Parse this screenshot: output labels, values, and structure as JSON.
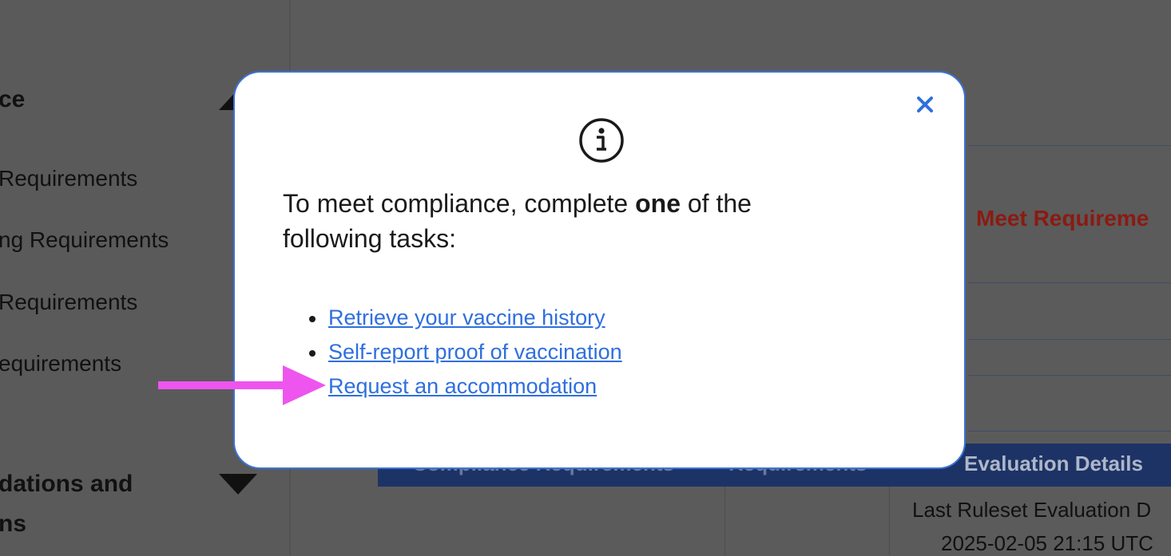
{
  "background": {
    "sidebar": {
      "section_top_title": "ce",
      "items": [
        " Requirements",
        "ng Requirements",
        "Requirements",
        "equirements"
      ],
      "section_bottom_title_line1": "dations and",
      "section_bottom_title_line2": "ns"
    },
    "main": {
      "status_text": "Meet Requireme",
      "table_headers": [
        "Compliance Requirements",
        "Requirements",
        "Evaluation Details"
      ],
      "last_evaluation_label": "Last Ruleset Evaluation D",
      "last_evaluation_value": "2025-02-05 21:15 UTC"
    }
  },
  "modal": {
    "heading_prefix": "To meet compliance, complete ",
    "heading_emphasis": "one",
    "heading_suffix": " of the following tasks:",
    "tasks": [
      "Retrieve your vaccine history",
      "Self-report proof of vaccination",
      "Request an accommodation"
    ],
    "close_icon": "close-icon",
    "info_icon": "info-icon"
  },
  "annotation": {
    "arrow_color": "#ee55ee",
    "arrow_target": "Request an accommodation"
  },
  "colors": {
    "link": "#2f6fde",
    "modal_border": "#3a73d9",
    "overlay": "#5b5b5b",
    "table_header": "#1d3366",
    "status_text": "#8b1a12"
  }
}
